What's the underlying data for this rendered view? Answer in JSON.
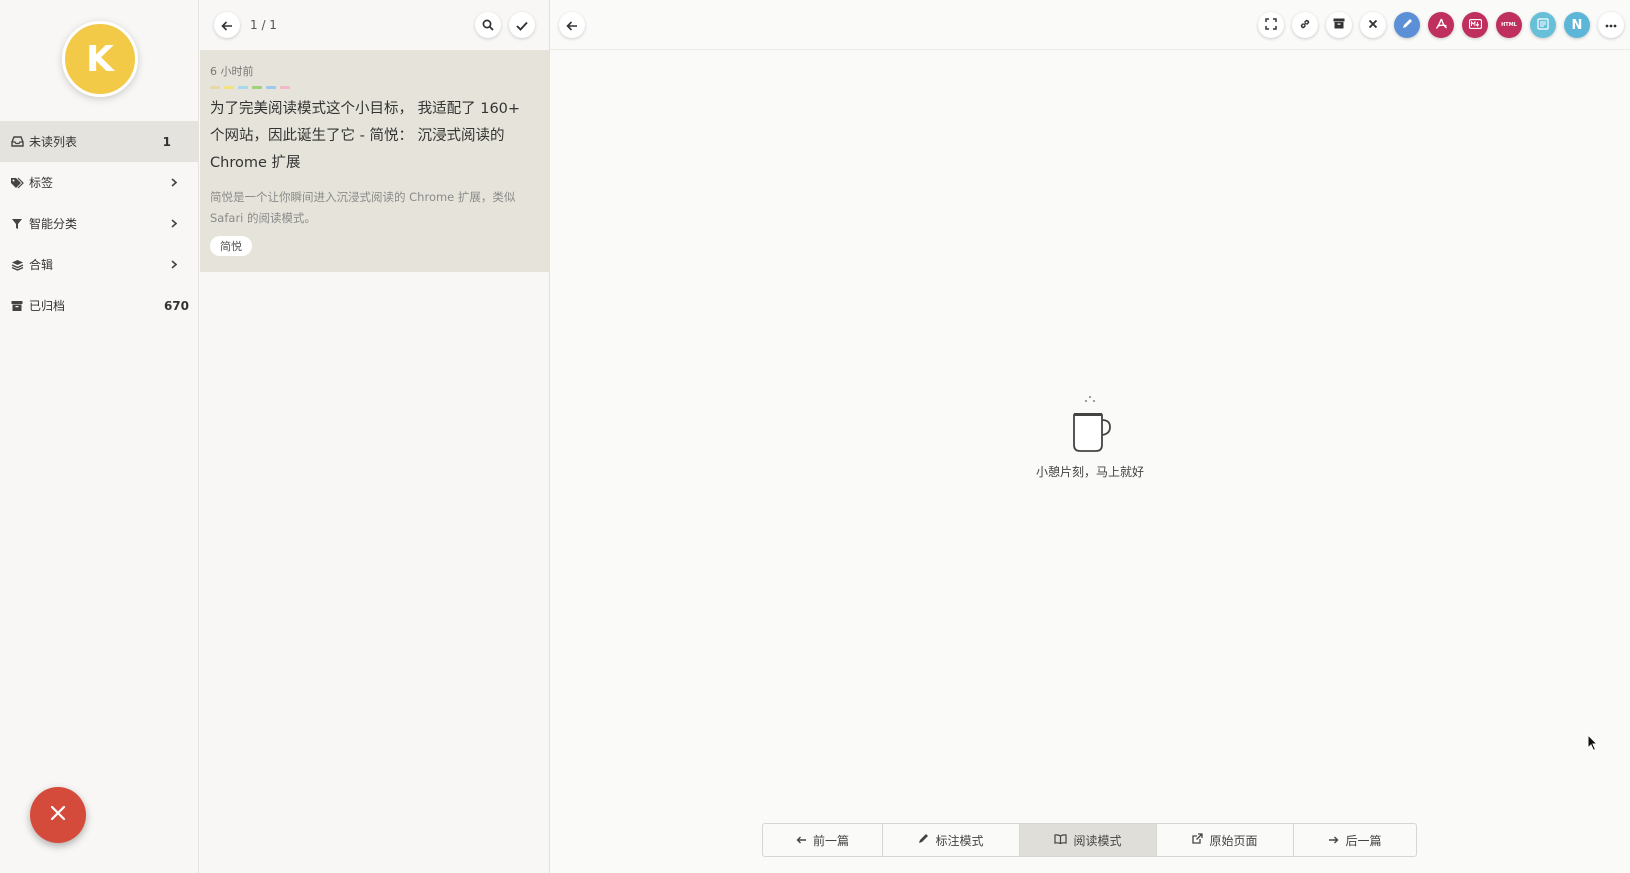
{
  "sidebar": {
    "avatar_letter": "K",
    "items": [
      {
        "icon": "inbox-icon",
        "label": "未读列表",
        "count": "1"
      },
      {
        "icon": "tags-icon",
        "label": "标签"
      },
      {
        "icon": "filter-icon",
        "label": "智能分类"
      },
      {
        "icon": "layers-icon",
        "label": "合辑"
      },
      {
        "icon": "archive-icon",
        "label": "已归档",
        "count": "670"
      }
    ],
    "fab_icon": "close-icon"
  },
  "list": {
    "pager": "1 / 1",
    "article": {
      "time": "6 小时前",
      "title": "为了完美阅读模式这个小目标， 我适配了 160+ 个网站，因此诞生了它 - 简悦： 沉浸式阅读的 Chrome 扩展",
      "description": "简悦是一个让你瞬间进入沉浸式阅读的 Chrome 扩展，类似 Safari 的阅读模式。",
      "tag": "简悦",
      "swatches": [
        "#e6d9a8",
        "#f1e27b",
        "#a9d8ea",
        "#9fd27a",
        "#9bc9f0",
        "#f2b8c6"
      ]
    }
  },
  "reader": {
    "toolbar": [
      {
        "icon": "fullscreen-icon",
        "color": "#ffffff"
      },
      {
        "icon": "link-icon",
        "color": "#ffffff"
      },
      {
        "icon": "archive-icon",
        "color": "#ffffff"
      },
      {
        "icon": "close-icon",
        "color": "#ffffff"
      },
      {
        "icon": "pen-icon",
        "color": "#5b8fd6"
      },
      {
        "icon": "pdf-icon",
        "color": "#c0305e"
      },
      {
        "icon": "markdown-icon",
        "color": "#c0305e"
      },
      {
        "icon": "html-icon",
        "color": "#c0305e",
        "label": "HTML"
      },
      {
        "icon": "image-icon",
        "color": "#67c0d8"
      },
      {
        "icon": "notion-icon",
        "color": "#5bb6d8",
        "label": "N"
      },
      {
        "icon": "more-icon",
        "color": "#ffffff"
      }
    ],
    "loading_message": "小憩片刻，马上就好",
    "bottom_bar": [
      {
        "icon": "arrow-left-icon",
        "label": "前一篇"
      },
      {
        "icon": "pencil-icon",
        "label": "标注模式"
      },
      {
        "icon": "book-icon",
        "label": "阅读模式",
        "active": true
      },
      {
        "icon": "external-link-icon",
        "label": "原始页面"
      },
      {
        "icon": "arrow-right-icon",
        "label": "后一篇"
      }
    ]
  }
}
